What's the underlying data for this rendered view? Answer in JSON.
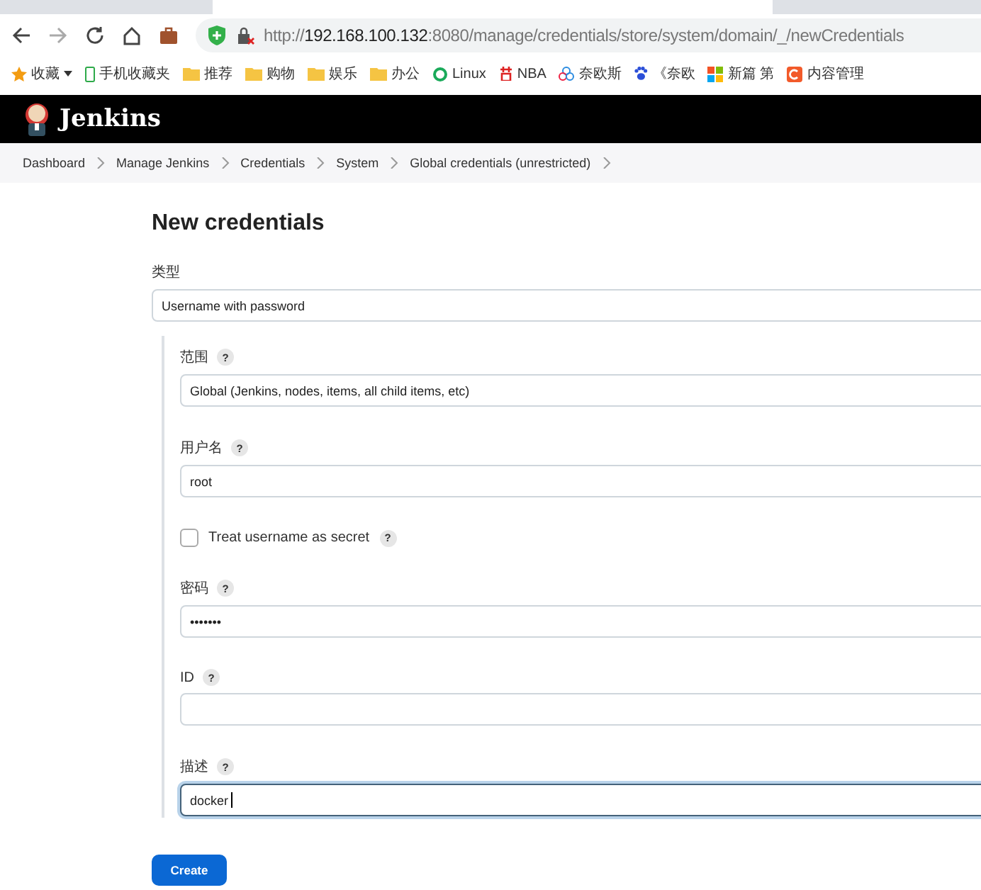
{
  "browser": {
    "url": {
      "scheme": "http://",
      "host": "192.168.100.132",
      "rest": ":8080/manage/credentials/store/system/domain/_/newCredentials"
    },
    "bookmarks": [
      {
        "kind": "star",
        "label": "收藏"
      },
      {
        "kind": "phone",
        "label": "手机收藏夹"
      },
      {
        "kind": "folder",
        "label": "推荐"
      },
      {
        "kind": "folder",
        "label": "购物"
      },
      {
        "kind": "folder",
        "label": "娱乐"
      },
      {
        "kind": "folder",
        "label": "办公"
      },
      {
        "kind": "ring",
        "label": "Linux"
      },
      {
        "kind": "glyph",
        "label": "NBA"
      },
      {
        "kind": "cloud",
        "label": "奈欧斯"
      },
      {
        "kind": "paw",
        "label": "《奈欧"
      },
      {
        "kind": "tiles",
        "label": "新篇 第"
      },
      {
        "kind": "square",
        "label": "内容管理"
      }
    ]
  },
  "header": {
    "title": "Jenkins"
  },
  "breadcrumb": [
    "Dashboard",
    "Manage Jenkins",
    "Credentials",
    "System",
    "Global credentials (unrestricted)"
  ],
  "form": {
    "title": "New credentials",
    "type_label": "类型",
    "type_value": "Username with password",
    "fields": [
      {
        "kind": "select",
        "label": "范围",
        "help": "?",
        "value": "Global (Jenkins, nodes, items, all child items, etc)",
        "focused": false
      },
      {
        "kind": "text",
        "label": "用户名",
        "help": "?",
        "value": "root",
        "focused": false
      },
      {
        "kind": "checkbox",
        "label": "Treat username as secret",
        "help": "?",
        "checked": false
      },
      {
        "kind": "text",
        "label": "密码",
        "help": "?",
        "value": "•••••••",
        "focused": false
      },
      {
        "kind": "text",
        "label": "ID",
        "help": "?",
        "focused": false
      },
      {
        "kind": "text",
        "label": "描述",
        "help": "?",
        "value": "docker",
        "focused": true
      }
    ],
    "submit": "Create"
  }
}
